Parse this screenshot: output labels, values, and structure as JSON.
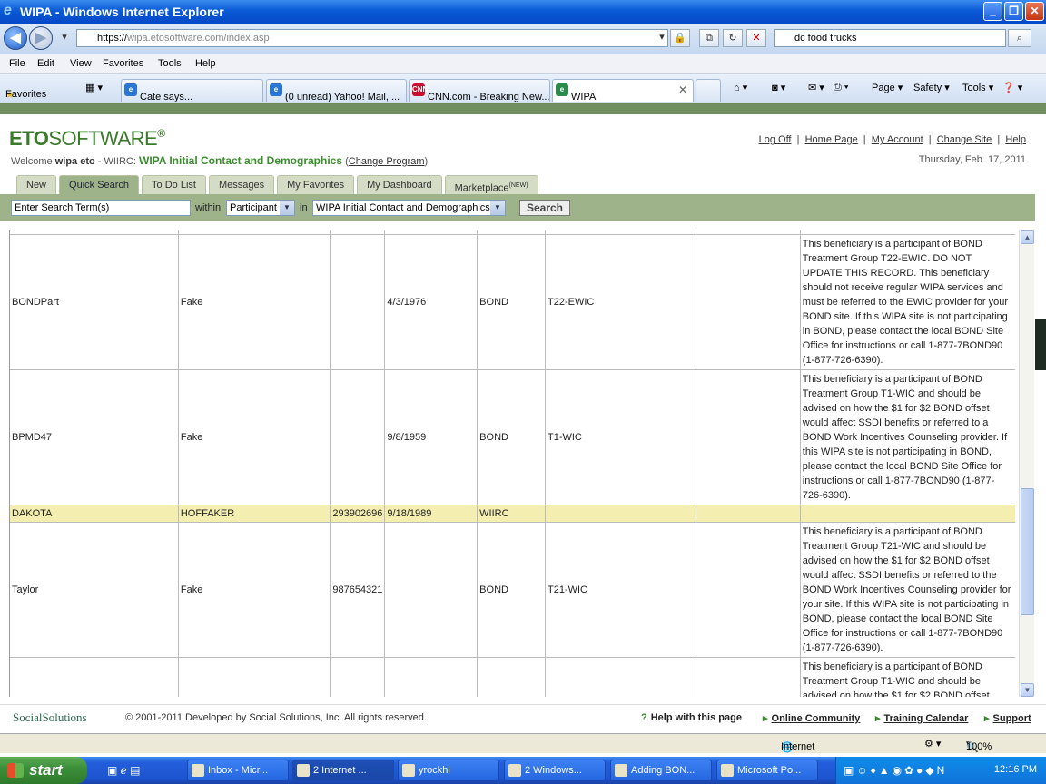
{
  "window": {
    "title": "WIPA - Windows Internet Explorer",
    "buttons": [
      "_",
      "❐",
      "✕"
    ]
  },
  "address": {
    "url_scheme": "https://",
    "url_rest": "wipa.etosoftware.com/index.asp",
    "search_value": "dc food trucks"
  },
  "menu": [
    "File",
    "Edit",
    "View",
    "Favorites",
    "Tools",
    "Help"
  ],
  "favbar": {
    "favorites_label": "Favorites",
    "tabs": [
      {
        "label": "Cate says...",
        "color": "#2a77d6"
      },
      {
        "label": "(0 unread) Yahoo! Mail, ...",
        "color": "#2a77d6"
      },
      {
        "label": "CNN.com - Breaking New...",
        "color": "#c8102e"
      },
      {
        "label": "WIPA",
        "color": "#2a8c4a"
      }
    ],
    "commands": [
      "Page ▾",
      "Safety ▾",
      "Tools ▾"
    ]
  },
  "header": {
    "logo_bold": "ETO",
    "logo_rest": "SOFTWARE",
    "logo_reg": "®",
    "welcome_prefix": "Welcome ",
    "user": "wipa eto",
    "site": " - WIIRC: ",
    "program": "WIPA Initial Contact and Demographics",
    "change_program": "Change Program",
    "links": [
      "Log Off",
      "Home Page",
      "My Account",
      "Change Site",
      "Help"
    ],
    "date": "Thursday, Feb. 17, 2011"
  },
  "tabs": [
    "New",
    "Quick Search",
    "To Do List",
    "Messages",
    "My Favorites",
    "My Dashboard",
    "Marketplace"
  ],
  "marketplace_badge": "(NEW)",
  "search": {
    "term_placeholder": "Enter Search Term(s)",
    "within_label": "within",
    "within_value": "Participant",
    "in_label": "in",
    "in_value": "WIPA Initial Contact and Demographics",
    "button": "Search"
  },
  "rows": [
    {
      "first": "BONDPart",
      "last": "Fake",
      "ssn": "",
      "dob": "4/3/1976",
      "site": "BOND",
      "group": "T22-EWIC",
      "extra": "",
      "note": "This beneficiary is a participant of BOND Treatment Group T22-EWIC. DO NOT UPDATE THIS RECORD. This beneficiary should not receive regular WIPA services and must be referred to the EWIC provider for your BOND site. If this WIPA site is not participating in BOND, please contact the local BOND Site Office for instructions or call 1-877-7BOND90 (1-877-726-6390)."
    },
    {
      "first": "BPMD47",
      "last": "Fake",
      "ssn": "",
      "dob": "9/8/1959",
      "site": "BOND",
      "group": "T1-WIC",
      "extra": "",
      "note": "This beneficiary is a participant of BOND Treatment Group T1-WIC and should be advised on how the $1 for $2 BOND offset would affect SSDI benefits or referred to a BOND Work Incentives Counseling provider. If this WIPA site is not participating in BOND, please contact the local BOND Site Office for instructions or call 1-877-7BOND90 (1-877-726-6390)."
    },
    {
      "first": "DAKOTA",
      "last": "HOFFAKER",
      "ssn": "293902696",
      "dob": "9/18/1989",
      "site": "WIIRC",
      "group": "",
      "extra": "",
      "note": ""
    },
    {
      "first": "Taylor",
      "last": "Fake",
      "ssn": "987654321",
      "dob": "",
      "site": "BOND",
      "group": "T21-WIC",
      "extra": "",
      "note": "This beneficiary is a participant of BOND Treatment Group T21-WIC and should be advised on how the $1 for $2 BOND offset would affect SSDI benefits or referred to the BOND Work Incentives Counseling provider for your site. If this WIPA site is not participating in BOND, please contact the local BOND Site Office for instructions or call 1-877-7BOND90 (1-877-726-6390)."
    },
    {
      "first": "",
      "last": "",
      "ssn": "",
      "dob": "",
      "site": "",
      "group": "",
      "extra": "",
      "note": "This beneficiary is a participant of BOND Treatment Group T1-WIC and should be advised on how the $1 for $2 BOND offset"
    }
  ],
  "footer": {
    "logo": "SocialSolutions",
    "copyright": "© 2001-2011 Developed by Social Solutions, Inc. All rights reserved.",
    "help": "Help with this page",
    "links": [
      "Online Community",
      "Training Calendar",
      "Support"
    ]
  },
  "status": {
    "zone": "Internet",
    "zoom": "100%"
  },
  "taskbar": {
    "start": "start",
    "items": [
      "Inbox - Micr...",
      "2 Internet ...",
      "yrockhi",
      "2 Windows...",
      "Adding BON...",
      "Microsoft Po..."
    ],
    "clock": "12:16 PM"
  }
}
